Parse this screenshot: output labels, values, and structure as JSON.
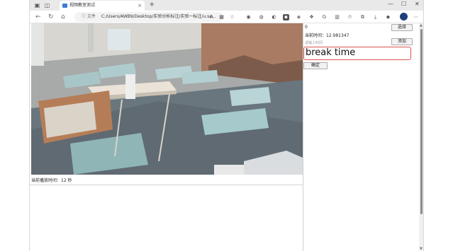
{
  "browser": {
    "tab_title": "视频教室测试",
    "address_label": "文件",
    "url": "C:/Users/AWB9/Desktop/实验分析标注/实验一标注/u.se...",
    "new_tab_symbol": "+",
    "close_symbol": "×"
  },
  "video": {
    "playback_status": "当前播放时间：12 秒"
  },
  "panel": {
    "top_value": "0",
    "select_button": "选择",
    "current_time": "当前时间：12.981347",
    "hint_text": "请输入时间",
    "add_button": "添加",
    "event_text": "break time",
    "confirm_button": "确定"
  },
  "colors": {
    "accent_border": "#d9534f",
    "profile": "#1f3f7a"
  }
}
